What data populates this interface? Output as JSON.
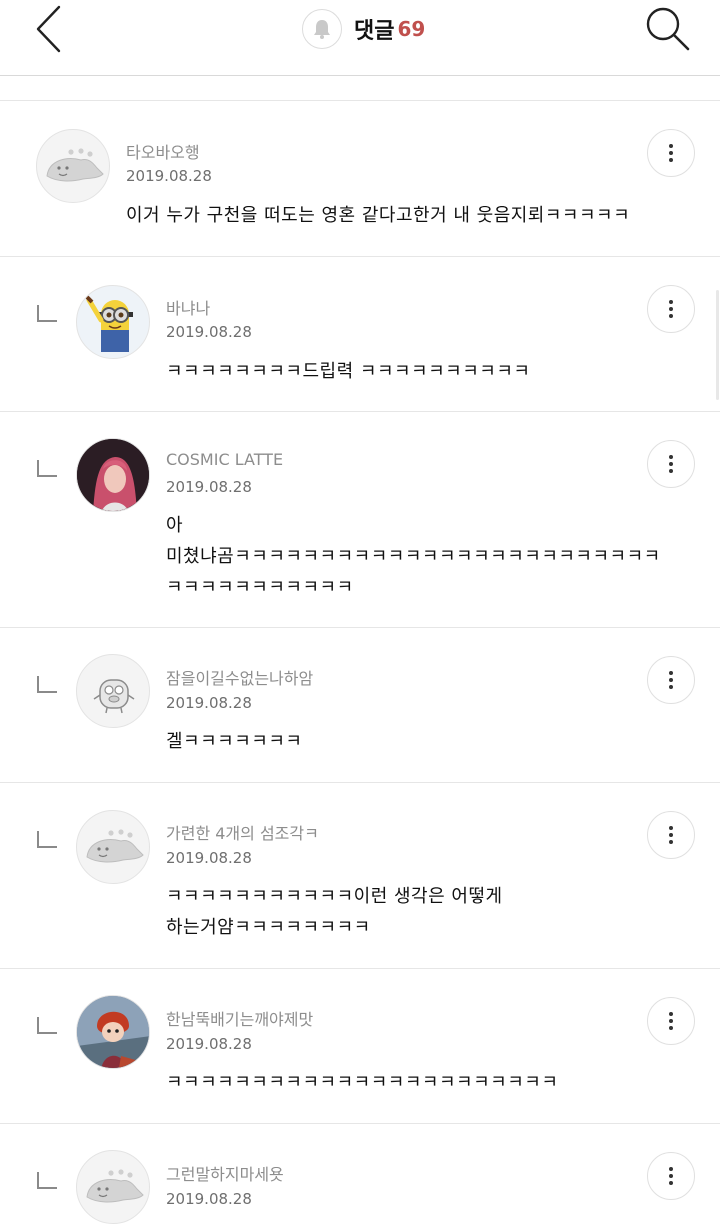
{
  "header": {
    "title": "댓글",
    "count": "69",
    "back_icon": "chevron-left-icon",
    "bell_icon": "bell-icon",
    "search_icon": "search-icon"
  },
  "colors": {
    "count_accent": "#c0504d",
    "divider": "#e6e6e6",
    "nickname": "#8d8d8d"
  },
  "comments": [
    {
      "nickname": "타오바오행",
      "date": "2019.08.28",
      "text": "이거 누가 구천을 떠도는 영혼 같다고한거 내 웃음지뢰ㅋㅋㅋㅋㅋ",
      "avatar": "dinosaur-avatar",
      "reply": false
    },
    {
      "nickname": "바냐나",
      "date": "2019.08.28",
      "text": "ㅋㅋㅋㅋㅋㅋㅋㅋ드립력 ㅋㅋㅋㅋㅋㅋㅋㅋㅋㅋ",
      "avatar": "minion-avatar",
      "reply": true
    },
    {
      "nickname": "COSMIC LATTE",
      "date": "2019.08.28",
      "text": "아\n미쳤냐곰ㅋㅋㅋㅋㅋㅋㅋㅋㅋㅋㅋㅋㅋㅋㅋㅋㅋㅋㅋㅋㅋㅋㅋㅋㅋ\nㅋㅋㅋㅋㅋㅋㅋㅋㅋㅋㅋ",
      "avatar": "photo-avatar",
      "reply": true
    },
    {
      "nickname": "잠을이길수없는나하암",
      "date": "2019.08.28",
      "text": "겔ㅋㅋㅋㅋㅋㅋㅋ",
      "avatar": "creature-avatar",
      "reply": true
    },
    {
      "nickname": "가련한 4개의 섬조각ㅋ",
      "date": "2019.08.28",
      "text": "ㅋㅋㅋㅋㅋㅋㅋㅋㅋㅋㅋ이런 생각은 어떻게\n하는거얌ㅋㅋㅋㅋㅋㅋㅋㅋ",
      "avatar": "dinosaur-avatar",
      "reply": true
    },
    {
      "nickname": "한남뚝배기는깨야제맛",
      "date": "2019.08.28",
      "text": "ㅋㅋㅋㅋㅋㅋㅋㅋㅋㅋㅋㅋㅋㅋㅋㅋㅋㅋㅋㅋㅋㅋㅋ",
      "avatar": "anime-avatar",
      "reply": true
    },
    {
      "nickname": "그런말하지마세욧",
      "date": "2019.08.28",
      "text": "",
      "avatar": "dinosaur-avatar",
      "reply": true
    }
  ]
}
